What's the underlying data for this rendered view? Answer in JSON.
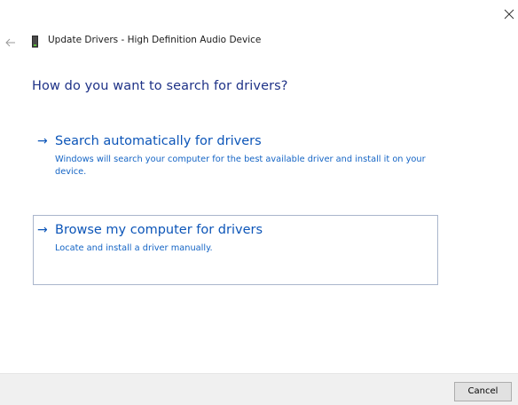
{
  "window": {
    "title": "Update Drivers - High Definition Audio Device",
    "close_icon": "close-icon",
    "back_icon": "back-arrow-icon",
    "device_icon": "audio-device-icon"
  },
  "heading": "How do you want to search for drivers?",
  "options": [
    {
      "arrow": "→",
      "title": "Search automatically for drivers",
      "description": "Windows will search your computer for the best available driver and install it on your device."
    },
    {
      "arrow": "→",
      "title": "Browse my computer for drivers",
      "description": "Locate and install a driver manually."
    }
  ],
  "footer": {
    "cancel_label": "Cancel"
  },
  "colors": {
    "heading": "#1e3287",
    "link": "#0c55b8",
    "description": "#1565c5",
    "focus_border": "#aab6cc",
    "footer_bg": "#f0f0f0"
  }
}
